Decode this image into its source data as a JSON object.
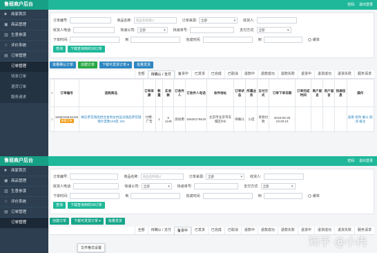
{
  "app": {
    "brand": "鲁班商户后台",
    "top_links": [
      "密码:",
      "退出登录"
    ],
    "accent": "#1fb89a",
    "sidebar_bg": "#2c3e50"
  },
  "sidebar": {
    "items": [
      {
        "label": "商家首页",
        "icon": "home-icon"
      },
      {
        "label": "商品管理",
        "icon": "goods-icon"
      },
      {
        "label": "生意参谋",
        "icon": "chart-icon"
      },
      {
        "label": "评价系统",
        "icon": "star-icon"
      },
      {
        "label": "订单管理",
        "icon": "order-icon"
      }
    ],
    "sub_items_top": [
      "订单管理",
      "待发订单",
      "退货订单",
      "服务请求"
    ],
    "sub_items_bottom": [
      "订单管理"
    ]
  },
  "filters": {
    "order_no": "订单编号:",
    "goods_name": "商品名称:",
    "goods_name_placeholder": "商品名称或id",
    "order_source": "订单来源:",
    "order_source_value": "全部",
    "receiver": "收货人:",
    "receiver_phone": "收货人电话:",
    "express": "快递公司:",
    "express_value": "全部",
    "express_no": "快递单号:",
    "pay_method": "支付方式:",
    "pay_method_value": "全部",
    "order_time": "下单时间:",
    "to": "到",
    "finish_time": "完成时间:",
    "risk": "缓单",
    "query_btn": "查询",
    "download_btn": "下载查询到的18订单"
  },
  "actions_top": [
    "批量确认订单",
    "创建订单",
    "下载可发货订单 ▾",
    "批量发货"
  ],
  "actions_bottom": [
    "创建订单",
    "下载可发货订单 ▾",
    "批量发货"
  ],
  "dropdown_item": "文件格式设置",
  "tabs": [
    "全部",
    "待确认 / 支付",
    "备货中",
    "已发货",
    "已完成",
    "已取消",
    "退款中",
    "退款成功",
    "退款失败",
    "退货中",
    "退货成功",
    "退货失败",
    "服务请求"
  ],
  "tabs_bottom": [
    "全部",
    "待确认 / 支付",
    "备货中",
    "已发货",
    "已完成",
    "已取消",
    "退款中",
    "退款成功",
    "退款失败",
    "退货中",
    "退货成功",
    "退货失败",
    "服务请求"
  ],
  "table": {
    "headers": [
      "订单编号",
      "选购商品",
      "订单来源",
      "数量",
      "实收款",
      "订收件人",
      "订收件人电话",
      "收件地址",
      "订单状态",
      "所属业务",
      "支付方式",
      "订单下单日期",
      "订单完成时间",
      "商户留言",
      "用户留言",
      "快递信息",
      "操作"
    ],
    "row": {
      "order_no": "3286225842425",
      "badge": "查看订单",
      "goods": "微信老花镜高档合金男女抗蓝光镜品老花镜镜片度数150度 150",
      "source": "付费·广告",
      "qty": "1",
      "amount": "¥ 1149",
      "receiver": "测试用",
      "phone": "15626176519",
      "address": "北京市北京市东城区hhh",
      "status": "待确认",
      "business": "小店",
      "pay": "货到付款",
      "date": "2018-06-29 18:29:16",
      "finish": "",
      "merchant_msg": "",
      "user_msg": "",
      "express": "",
      "ops": "查看 修改 确认 取消 备注"
    }
  },
  "watermark": "知乎 @小冉"
}
